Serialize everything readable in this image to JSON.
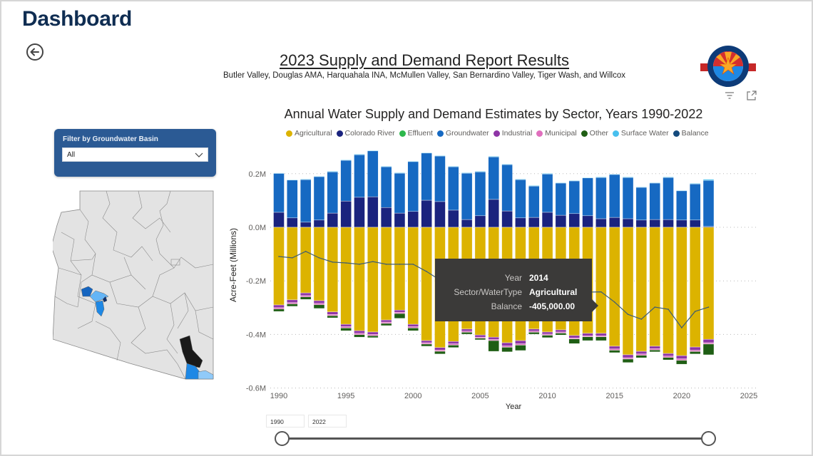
{
  "page": {
    "title": "Dashboard",
    "back_button": "back-arrow-icon"
  },
  "report": {
    "title": "2023 Supply and Demand Report Results",
    "subtitle": "Butler Valley, Douglas AMA, Harquahala INA, McMullen Valley, San Bernardino Valley, Tiger Wash, and Willcox",
    "logo_alt": "Arizona Department of Water Resources"
  },
  "visual_actions": {
    "filter_icon": "filter-icon",
    "focus_icon": "focus-mode-icon"
  },
  "filter": {
    "label": "Filter by Groundwater Basin",
    "selected": "All"
  },
  "map": {
    "highlight_colors": [
      "#1565c0",
      "#64b5f6",
      "#1e88e5",
      "#0d2f6b",
      "#1a1a1a",
      "#90caf9"
    ],
    "base_color": "#e3e3e3"
  },
  "tooltip": {
    "rows": [
      {
        "key": "Year",
        "value": "2014"
      },
      {
        "key": "Sector/WaterType",
        "value": "Agricultural"
      },
      {
        "key": "Balance",
        "value": "-405,000.00"
      }
    ]
  },
  "range": {
    "start": "1990",
    "end": "2022",
    "start_fraction": 0,
    "end_fraction": 1
  },
  "chart_data": {
    "type": "bar",
    "stacked": true,
    "title": "Annual Water Supply and Demand Estimates by Sector, Years 1990-2022",
    "xlabel": "Year",
    "ylabel": "Acre-Feet (Millions)",
    "xlim": [
      1990,
      2025
    ],
    "ylim": [
      -0.6,
      0.25
    ],
    "xticks": [
      "1990",
      "1995",
      "2000",
      "2005",
      "2010",
      "2015",
      "2020",
      "2025"
    ],
    "yticks": [
      {
        "value": 0.2,
        "label": "0.2M"
      },
      {
        "value": 0.0,
        "label": "0.0M"
      },
      {
        "value": -0.2,
        "label": "-0.2M"
      },
      {
        "value": -0.4,
        "label": "-0.4M"
      },
      {
        "value": -0.6,
        "label": "-0.6M"
      }
    ],
    "grid": true,
    "legend_position": "top",
    "legend": [
      {
        "name": "Agricultural",
        "color": "#dcb300"
      },
      {
        "name": "Colorado River",
        "color": "#1a237e"
      },
      {
        "name": "Effluent",
        "color": "#2db84c"
      },
      {
        "name": "Groundwater",
        "color": "#1669c2"
      },
      {
        "name": "Industrial",
        "color": "#8e35a6"
      },
      {
        "name": "Municipal",
        "color": "#e06fbd"
      },
      {
        "name": "Other",
        "color": "#1f5e14"
      },
      {
        "name": "Surface Water",
        "color": "#48c0ee"
      },
      {
        "name": "Balance",
        "color": "#144a7d"
      }
    ],
    "x": [
      1990,
      1991,
      1992,
      1993,
      1994,
      1995,
      1996,
      1997,
      1998,
      1999,
      2000,
      2001,
      2002,
      2003,
      2004,
      2005,
      2006,
      2007,
      2008,
      2009,
      2010,
      2011,
      2012,
      2013,
      2014,
      2015,
      2016,
      2017,
      2018,
      2019,
      2020,
      2021,
      2022
    ],
    "series": [
      {
        "name": "Colorado River",
        "values": [
          0.056,
          0.035,
          0.019,
          0.027,
          0.053,
          0.098,
          0.112,
          0.114,
          0.074,
          0.053,
          0.059,
          0.101,
          0.096,
          0.064,
          0.029,
          0.043,
          0.104,
          0.061,
          0.035,
          0.037,
          0.056,
          0.045,
          0.051,
          0.043,
          0.032,
          0.037,
          0.032,
          0.027,
          0.029,
          0.029,
          0.027,
          0.027,
          0.003
        ]
      },
      {
        "name": "Groundwater",
        "values": [
          0.145,
          0.141,
          0.159,
          0.162,
          0.154,
          0.152,
          0.159,
          0.171,
          0.152,
          0.149,
          0.186,
          0.176,
          0.17,
          0.162,
          0.173,
          0.164,
          0.159,
          0.173,
          0.143,
          0.117,
          0.143,
          0.12,
          0.122,
          0.141,
          0.154,
          0.16,
          0.154,
          0.122,
          0.136,
          0.157,
          0.109,
          0.135,
          0.172
        ]
      },
      {
        "name": "Surface Water",
        "values": [
          0.002,
          0.002,
          0.002,
          0.002,
          0.002,
          0.002,
          0.002,
          0.002,
          0.002,
          0.002,
          0.002,
          0.002,
          0.002,
          0.002,
          0.002,
          0.002,
          0.002,
          0.002,
          0.002,
          0.002,
          0.002,
          0.002,
          0.002,
          0.002,
          0.002,
          0.002,
          0.002,
          0.002,
          0.002,
          0.002,
          0.002,
          0.002,
          0.004
        ]
      },
      {
        "name": "Agricultural",
        "values": [
          -0.29,
          -0.271,
          -0.245,
          -0.274,
          -0.316,
          -0.362,
          -0.386,
          -0.391,
          -0.346,
          -0.309,
          -0.362,
          -0.423,
          -0.449,
          -0.426,
          -0.38,
          -0.402,
          -0.41,
          -0.431,
          -0.423,
          -0.38,
          -0.391,
          -0.383,
          -0.404,
          -0.396,
          -0.396,
          -0.444,
          -0.476,
          -0.463,
          -0.444,
          -0.471,
          -0.479,
          -0.447,
          -0.418
        ]
      },
      {
        "name": "Industrial",
        "values": [
          -0.01,
          -0.01,
          -0.01,
          -0.01,
          -0.009,
          -0.009,
          -0.01,
          -0.009,
          -0.008,
          -0.008,
          -0.009,
          -0.008,
          -0.009,
          -0.009,
          -0.008,
          -0.008,
          -0.009,
          -0.012,
          -0.012,
          -0.008,
          -0.008,
          -0.008,
          -0.009,
          -0.009,
          -0.009,
          -0.01,
          -0.011,
          -0.01,
          -0.009,
          -0.01,
          -0.012,
          -0.012,
          -0.013
        ]
      },
      {
        "name": "Municipal",
        "values": [
          -0.005,
          -0.005,
          -0.005,
          -0.005,
          -0.005,
          -0.005,
          -0.005,
          -0.005,
          -0.005,
          -0.005,
          -0.005,
          -0.005,
          -0.005,
          -0.005,
          -0.004,
          -0.004,
          -0.004,
          -0.005,
          -0.005,
          -0.004,
          -0.004,
          -0.004,
          -0.004,
          -0.004,
          -0.004,
          -0.005,
          -0.005,
          -0.005,
          -0.005,
          -0.005,
          -0.006,
          -0.005,
          -0.005
        ]
      },
      {
        "name": "Effluent",
        "values": [
          0,
          0,
          0,
          0,
          0,
          0,
          0,
          0,
          0,
          0,
          0,
          0,
          0,
          0,
          0,
          0,
          0,
          0,
          0,
          0,
          0,
          0,
          0,
          0,
          0,
          0,
          0,
          0,
          0,
          0,
          0,
          0,
          0
        ]
      },
      {
        "name": "Other",
        "values": [
          -0.009,
          -0.009,
          -0.009,
          -0.014,
          -0.008,
          -0.01,
          -0.009,
          -0.007,
          -0.008,
          -0.018,
          -0.01,
          -0.008,
          -0.01,
          -0.009,
          -0.007,
          -0.006,
          -0.04,
          -0.017,
          -0.02,
          -0.007,
          -0.009,
          -0.007,
          -0.017,
          -0.014,
          -0.014,
          -0.009,
          -0.013,
          -0.009,
          -0.007,
          -0.009,
          -0.014,
          -0.009,
          -0.04
        ]
      }
    ],
    "balance": {
      "name": "Balance",
      "values": [
        -0.109,
        -0.114,
        -0.09,
        -0.114,
        -0.13,
        -0.133,
        -0.138,
        -0.128,
        -0.138,
        -0.138,
        -0.138,
        -0.165,
        -0.197,
        -0.23,
        -0.25,
        -0.258,
        -0.262,
        -0.262,
        -0.258,
        -0.25,
        -0.25,
        -0.242,
        -0.242,
        -0.242,
        -0.241,
        -0.279,
        -0.325,
        -0.343,
        -0.298,
        -0.306,
        -0.375,
        -0.314,
        -0.298
      ]
    }
  }
}
